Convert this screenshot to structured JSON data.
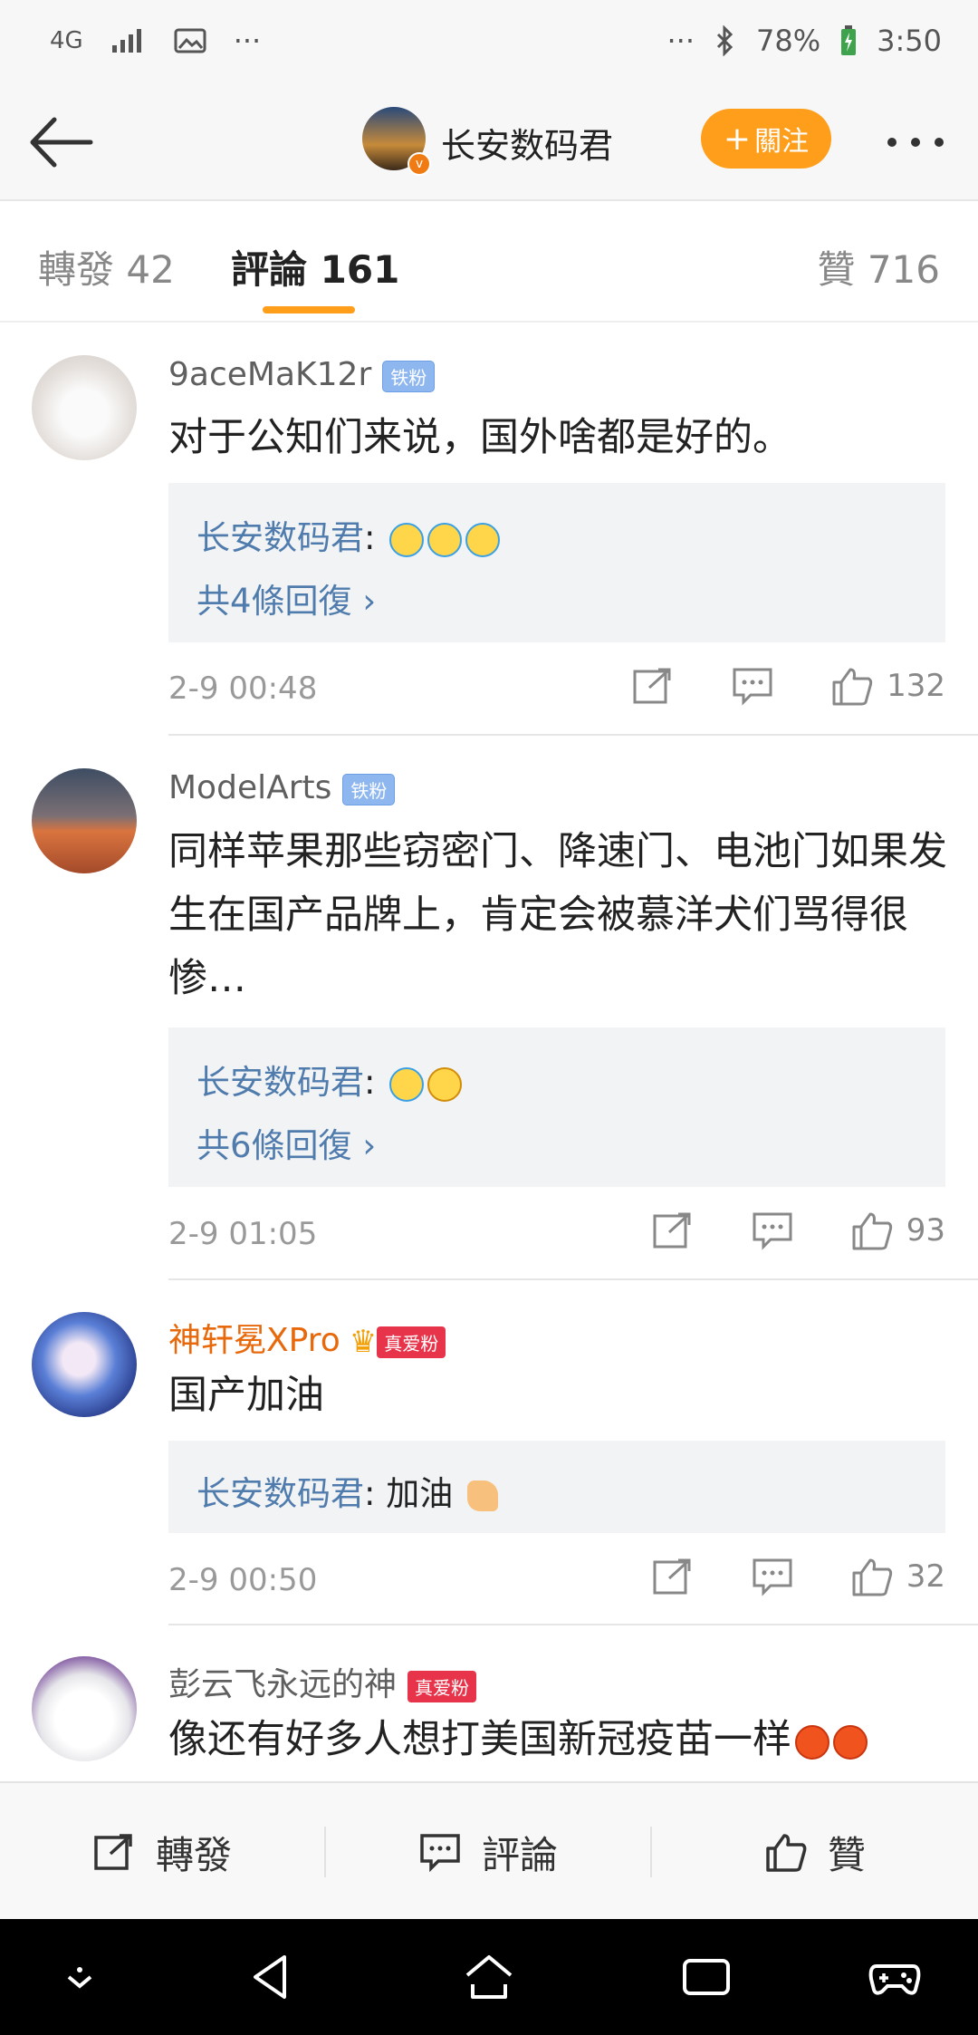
{
  "status_bar": {
    "network": "4G",
    "dots_left": "···",
    "dots_right": "···",
    "battery": "78%",
    "time": "3:50"
  },
  "header": {
    "name": "长安数码君",
    "follow_label": "關注"
  },
  "tabs": {
    "repost": "轉發 42",
    "comments": "評論 161",
    "likes": "贊 716"
  },
  "comments": [
    {
      "user": "9aceMaK12r",
      "badge": "铁粉",
      "text": "对于公知们来说，国外啥都是好的。",
      "reply_user": "长安数码君",
      "reply_text": ":",
      "more_replies": "共4條回復",
      "time": "2-9 00:48",
      "likes": "132"
    },
    {
      "user": "ModelArts",
      "badge": "铁粉",
      "text": "同样苹果那些窃密门、降速门、电池门如果发生在国产品牌上，肯定会被慕洋犬们骂得很惨…",
      "reply_user": "长安数码君",
      "reply_text": ":",
      "more_replies": "共6條回復",
      "time": "2-9 01:05",
      "likes": "93"
    },
    {
      "user": "神轩冕XPro",
      "badge": "真爱粉",
      "text": "国产加油",
      "reply_user": "长安数码君",
      "reply_text": ": 加油",
      "time": "2-9 00:50",
      "likes": "32"
    },
    {
      "user": "彭云飞永远的神",
      "badge": "真爱粉",
      "text": "像还有好多人想打美国新冠疫苗一样"
    }
  ],
  "bottom_bar": {
    "repost": "轉發",
    "comment": "評論",
    "like": "贊"
  },
  "colors": {
    "accent": "#ff9e1b",
    "link": "#4f7cad",
    "vip_name": "#e8690c"
  }
}
